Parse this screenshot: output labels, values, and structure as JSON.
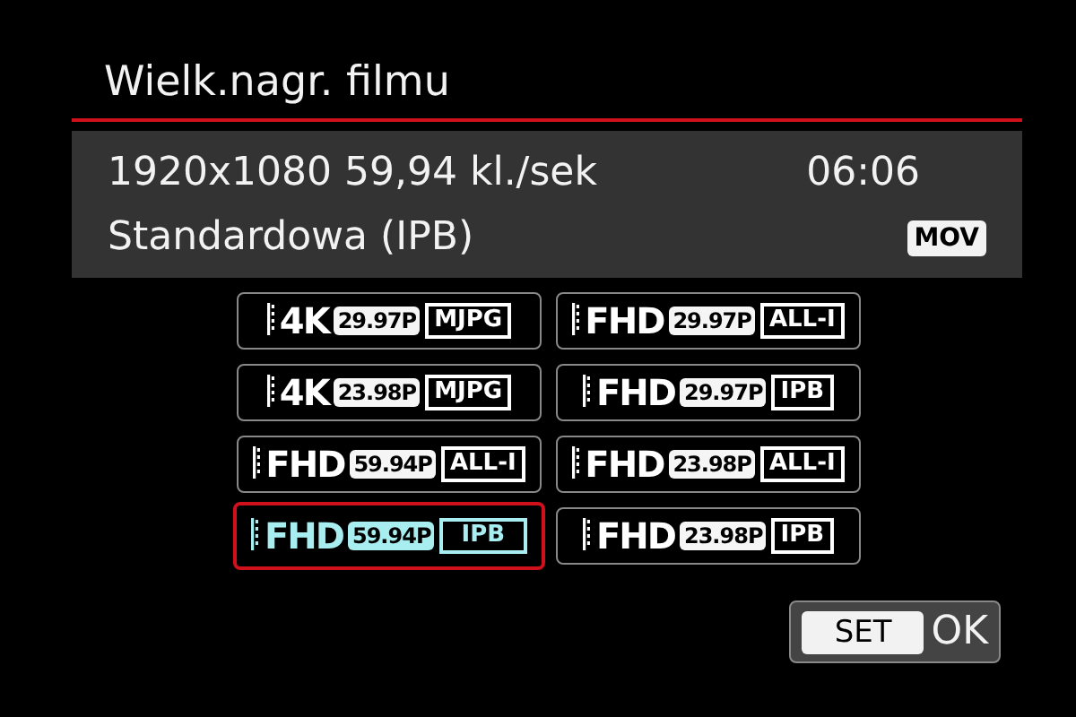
{
  "title": "Wielk.nagr. filmu",
  "info": {
    "resolution": "1920x1080 59,94 kl./sek",
    "time": "06:06",
    "quality": "Standardowa (IPB)",
    "format": "MOV"
  },
  "options": [
    {
      "size": "4K",
      "fps": "29.97P",
      "compression": "MJPG",
      "selected": false
    },
    {
      "size": "FHD",
      "fps": "29.97P",
      "compression": "ALL-I",
      "selected": false
    },
    {
      "size": "4K",
      "fps": "23.98P",
      "compression": "MJPG",
      "selected": false
    },
    {
      "size": "FHD",
      "fps": "29.97P",
      "compression": "IPB",
      "selected": false
    },
    {
      "size": "FHD",
      "fps": "59.94P",
      "compression": "ALL-I",
      "selected": false
    },
    {
      "size": "FHD",
      "fps": "23.98P",
      "compression": "ALL-I",
      "selected": false
    },
    {
      "size": "FHD",
      "fps": "59.94P",
      "compression": "IPB",
      "selected": true
    },
    {
      "size": "FHD",
      "fps": "23.98P",
      "compression": "IPB",
      "selected": false
    }
  ],
  "ok_button": {
    "key": "SET",
    "label": "OK"
  }
}
